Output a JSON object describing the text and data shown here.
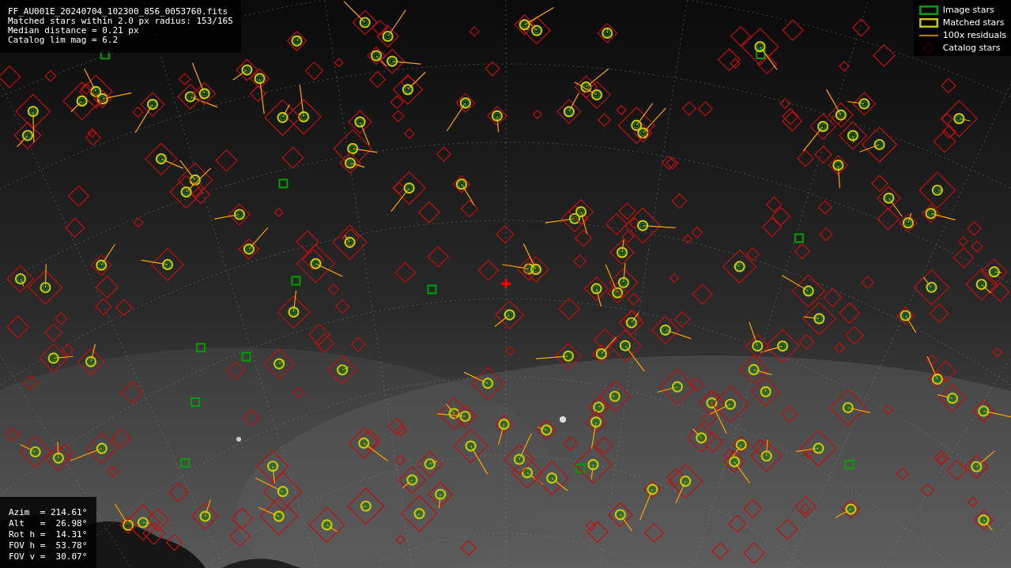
{
  "header": {
    "lines": [
      "FF_AU001E_20240704_102300_856_0053760.fits",
      "Matched stars within 2.0 px radius: 153/165",
      "Median distance = 0.21 px",
      "Catalog lim mag = 6.2"
    ]
  },
  "legend": [
    {
      "label": "Image stars"
    },
    {
      "kind": "matched",
      "label": "Matched stars"
    },
    {
      "kind": "residual",
      "label": "100x residuals"
    },
    {
      "kind": "catalog",
      "label": "Catalog stars"
    }
  ],
  "pointing": {
    "lines": [
      "Azim  = 214.61°",
      "Alt   =  26.98°",
      "Rot h =  14.31°",
      "FOV h =  53.78°",
      "FOV v =  30.07°"
    ]
  }
}
